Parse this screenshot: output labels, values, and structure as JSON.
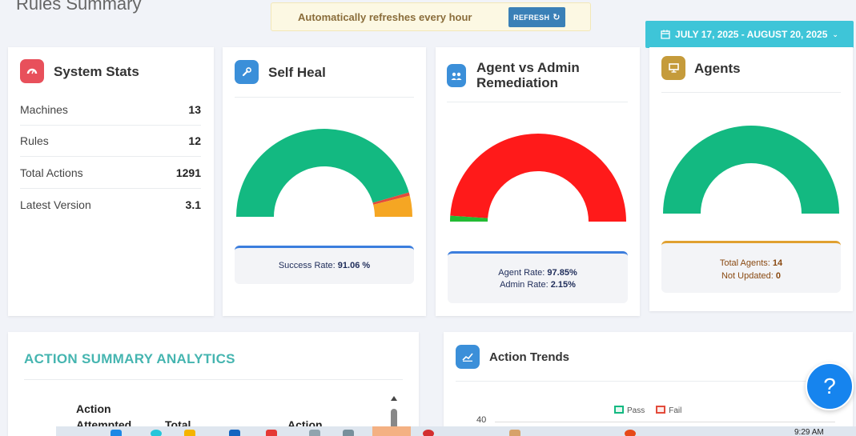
{
  "page": {
    "title": "Rules Summary"
  },
  "refresh": {
    "text": "Automatically refreshes every hour",
    "button": "REFRESH",
    "button_icon": "refresh-icon"
  },
  "date_range": {
    "label": "JULY 17, 2025 - AUGUST 20, 2025",
    "icon": "calendar-icon"
  },
  "system_stats": {
    "title": "System Stats",
    "icon": "dashboard-icon",
    "icon_color": "#e8505b",
    "rows": [
      {
        "label": "Machines",
        "value": "13"
      },
      {
        "label": "Rules",
        "value": "12"
      },
      {
        "label": "Total Actions",
        "value": "1291"
      },
      {
        "label": "Latest Version",
        "value": "3.1"
      }
    ]
  },
  "self_heal": {
    "title": "Self Heal",
    "icon": "wrench-icon",
    "icon_color": "#3b8fd9",
    "success_label": "Success Rate:",
    "success_value": "91.06 %",
    "gauge": {
      "success": 0.9106,
      "fail": 0.0894,
      "colors": [
        "#13b981",
        "#e34b3b",
        "#f5a623"
      ]
    }
  },
  "agent_admin": {
    "title_line1": "Agent vs Admin",
    "title_line2": "Remediation",
    "icon": "users-icon",
    "icon_color": "#3b8fd9",
    "agent_label": "Agent Rate:",
    "agent_value": "97.85%",
    "admin_label": "Admin Rate:",
    "admin_value": "2.15%",
    "gauge": {
      "agent": 0.9785,
      "admin": 0.0215,
      "colors": [
        "#ff1a1a",
        "#22bb33"
      ]
    }
  },
  "agents": {
    "title": "Agents",
    "icon": "monitor-icon",
    "icon_color": "#c59b3b",
    "total_label": "Total Agents:",
    "total_value": "14",
    "not_updated_label": "Not Updated:",
    "not_updated_value": "0",
    "gauge": {
      "updated": 1.0,
      "colors": [
        "#13b981"
      ]
    }
  },
  "action_summary": {
    "title": "ACTION SUMMARY ANALYTICS",
    "col1_line1": "Action",
    "col1_line2": "Attempted",
    "col2": "Total",
    "col3": "Action"
  },
  "action_trends": {
    "title": "Action Trends",
    "icon": "chart-icon",
    "icon_color": "#3b8fd9",
    "legend": [
      {
        "label": "Pass",
        "color": "#13b981"
      },
      {
        "label": "Fail",
        "color": "#e34b3b"
      }
    ],
    "y_top": "40"
  },
  "help": {
    "label": "?"
  },
  "taskbar": {
    "clock": "9:29 AM"
  }
}
